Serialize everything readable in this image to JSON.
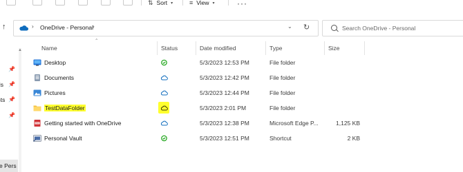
{
  "toolbar": {
    "sort_label": "Sort",
    "view_label": "View",
    "more_label": "···"
  },
  "address": {
    "caret": "›",
    "path": "OneDrive - Personal",
    "dropdown": "⌄",
    "refresh": "↻"
  },
  "search": {
    "placeholder": "Search OneDrive - Personal"
  },
  "nav": {
    "partial_items": [
      "ds",
      "nts",
      "e Pers"
    ]
  },
  "columns": {
    "name": "Name",
    "status": "Status",
    "date_modified": "Date modified",
    "type": "Type",
    "size": "Size"
  },
  "files": [
    {
      "name": "Desktop",
      "icon": "desktop-folder-icon",
      "status": "available-check",
      "date": "5/3/2023 12:53 PM",
      "type": "File folder",
      "size": ""
    },
    {
      "name": "Documents",
      "icon": "documents-folder-icon",
      "status": "online-cloud",
      "date": "5/3/2023 12:42 PM",
      "type": "File folder",
      "size": ""
    },
    {
      "name": "Pictures",
      "icon": "pictures-folder-icon",
      "status": "online-cloud",
      "date": "5/3/2023 12:44 PM",
      "type": "File folder",
      "size": ""
    },
    {
      "name": "TestDataFolder",
      "icon": "folder-icon",
      "status": "online-cloud-highlighted",
      "date": "5/3/2023 2:01 PM",
      "type": "File folder",
      "size": ""
    },
    {
      "name": "Getting started with OneDrive",
      "icon": "pdf-icon",
      "status": "online-cloud",
      "date": "5/3/2023 12:38 PM",
      "type": "Microsoft Edge P...",
      "size": "1,125 KB"
    },
    {
      "name": "Personal Vault",
      "icon": "vault-shortcut-icon",
      "status": "available-check",
      "date": "5/3/2023 12:51 PM",
      "type": "Shortcut",
      "size": "2 KB"
    }
  ],
  "colors": {
    "highlight": "#ffff2e",
    "cloud_blue": "#0f6cbd",
    "check_green": "#13a10e"
  }
}
